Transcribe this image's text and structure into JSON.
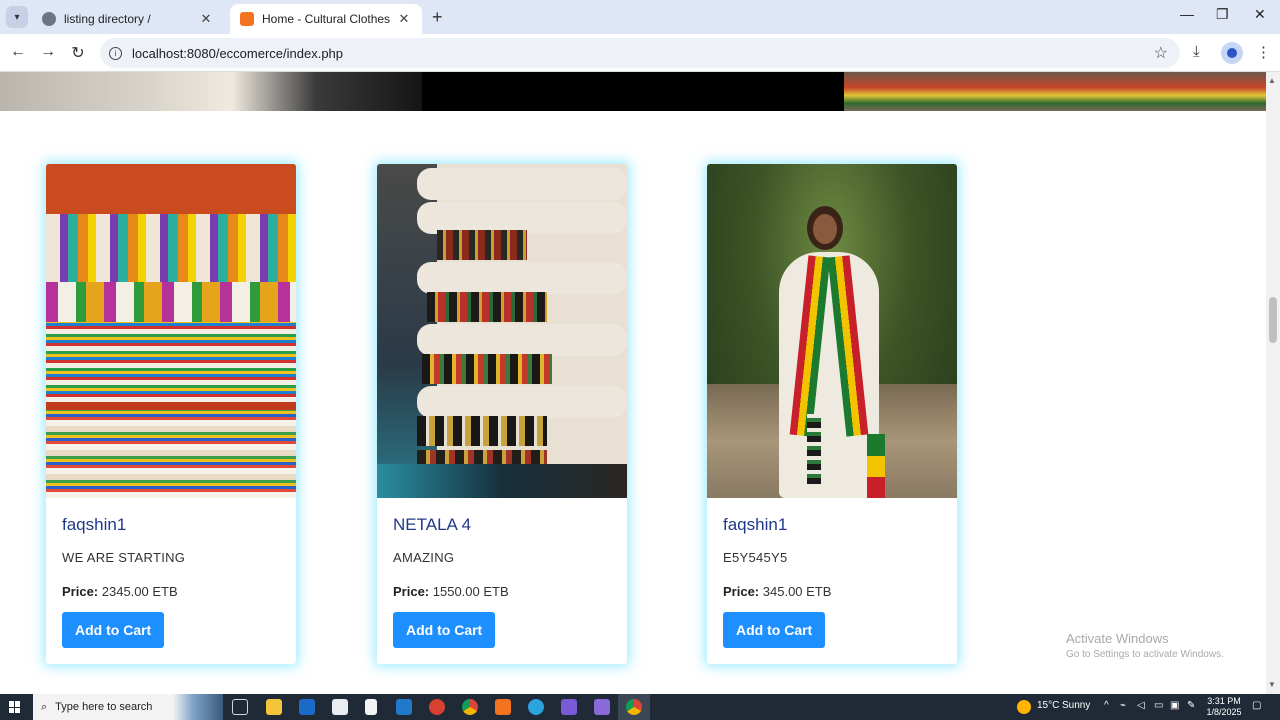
{
  "browser": {
    "tabs": [
      {
        "title": "listing directory /",
        "active": false
      },
      {
        "title": "Home - Cultural Clothes",
        "active": true
      }
    ],
    "url": "localhost:8080/eccomerce/index.php",
    "new_tab_icon": "+",
    "controls": {
      "minimize": "—",
      "maximize": "❐",
      "close": "✕"
    }
  },
  "products": [
    {
      "name": "faqshin1",
      "description": "WE ARE STARTING",
      "price_label": "Price:",
      "price": "2345.00 ETB",
      "button": "Add to Cart",
      "image": "colorful-scarves"
    },
    {
      "name": "NETALA 4",
      "description": "AMAZING",
      "price_label": "Price:",
      "price": "1550.00 ETB",
      "button": "Add to Cart",
      "image": "folded-fabric"
    },
    {
      "name": "faqshin1",
      "description": "E5Y545Y5",
      "price_label": "Price:",
      "price": "345.00 ETB",
      "button": "Add to Cart",
      "image": "woman-traditional-dress"
    }
  ],
  "watermark": {
    "title": "Activate Windows",
    "subtitle": "Go to Settings to activate Windows."
  },
  "taskbar": {
    "search_placeholder": "Type here to search",
    "weather_temp": "15°C",
    "weather_text": "Sunny",
    "time": "3:31 PM",
    "date": "1/8/2025"
  },
  "colors": {
    "accent": "#1e8fff",
    "name": "#1f3a8a",
    "glow": "#5adcff"
  }
}
